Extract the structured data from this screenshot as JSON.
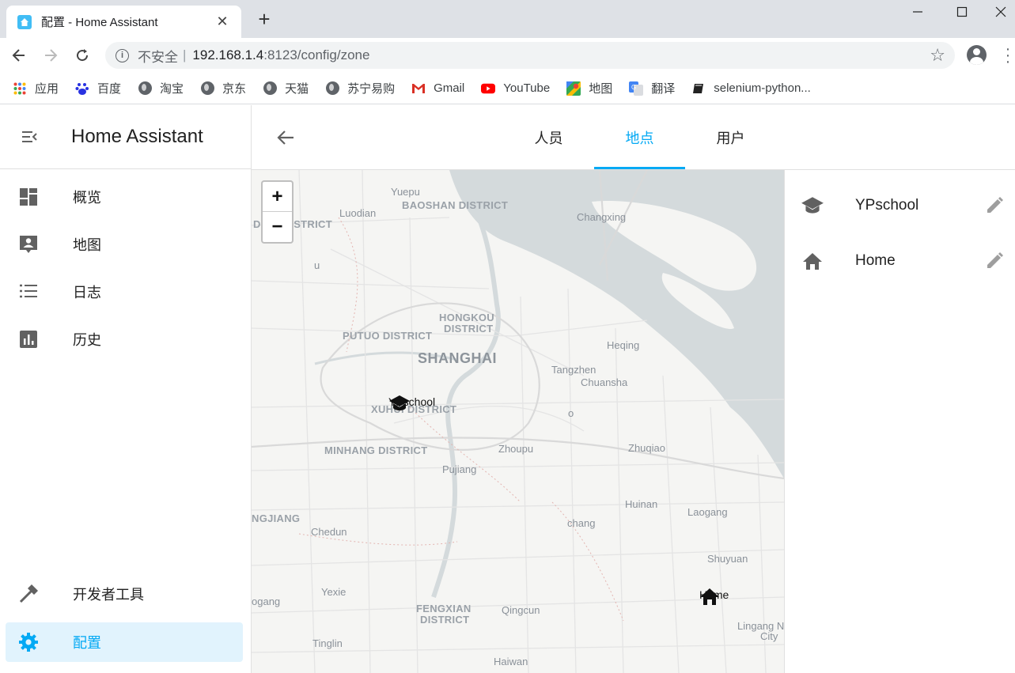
{
  "browser": {
    "tab_title": "配置 - Home Assistant",
    "new_tab": "+",
    "address": {
      "insecure_label": "不安全",
      "separator": "|",
      "host": "192.168.1.4",
      "path": ":8123/config/zone"
    },
    "bookmarks": [
      {
        "label": "应用",
        "icon": "apps-grid-icon"
      },
      {
        "label": "百度",
        "icon": "baidu-paw-icon"
      },
      {
        "label": "淘宝",
        "icon": "globe-icon"
      },
      {
        "label": "京东",
        "icon": "globe-icon"
      },
      {
        "label": "天猫",
        "icon": "globe-icon"
      },
      {
        "label": "苏宁易购",
        "icon": "globe-icon"
      },
      {
        "label": "Gmail",
        "icon": "gmail-icon"
      },
      {
        "label": "YouTube",
        "icon": "youtube-icon"
      },
      {
        "label": "地图",
        "icon": "maps-icon"
      },
      {
        "label": "翻译",
        "icon": "translate-icon"
      },
      {
        "label": "selenium-python...",
        "icon": "book-icon"
      }
    ]
  },
  "sidebar": {
    "title": "Home Assistant",
    "items": [
      {
        "label": "概览",
        "icon": "dashboard-icon"
      },
      {
        "label": "地图",
        "icon": "map-account-icon"
      },
      {
        "label": "日志",
        "icon": "logbook-list-icon"
      },
      {
        "label": "历史",
        "icon": "history-chart-icon"
      }
    ],
    "bottom_items": [
      {
        "label": "开发者工具",
        "icon": "hammer-icon"
      },
      {
        "label": "配置",
        "icon": "cog-icon",
        "active": true
      }
    ]
  },
  "topbar": {
    "tabs": [
      {
        "label": "人员",
        "active": false
      },
      {
        "label": "地点",
        "active": true
      },
      {
        "label": "用户",
        "active": false
      }
    ]
  },
  "map": {
    "zoom_in": "+",
    "zoom_out": "−",
    "labels": {
      "yuepu": "Yuepu",
      "baoshan": "BAOSHAN DISTRICT",
      "luodian": "Luodian",
      "jiading": "DING DISTRICT",
      "changxing": "Changxing",
      "hongkou1": "HONGKOU",
      "hongkou2": "DISTRICT",
      "putuo": "PUTUO DISTRICT",
      "shanghai": "SHANGHAI",
      "heqing": "Heqing",
      "tangzhen": "Tangzhen",
      "chuansha": "Chuansha",
      "xuhui": "XUHUI DISTRICT",
      "minhang": "MINHANG DISTRICT",
      "zhoupu": "Zhoupu",
      "zhuqiao": "Zhuqiao",
      "pujiang": "Pujiang",
      "huinan": "Huinan",
      "laogang": "Laogang",
      "songjiang": "NGJIANG",
      "chedun": "Chedun",
      "chang": "chang",
      "shuyuan": "Shuyuan",
      "yexie": "Yexie",
      "ogang": "ogang",
      "fengxian1": "FENGXIAN",
      "fengxian2": "DISTRICT",
      "qingcun": "Qingcun",
      "lingang1": "Lingang N",
      "lingang2": "City",
      "tinglin": "Tinglin",
      "haiwan": "Haiwan",
      "u": "u",
      "o": "o"
    },
    "markers": [
      {
        "label": "YPschool",
        "icon": "school-icon"
      },
      {
        "label": "Home",
        "icon": "home-icon"
      }
    ]
  },
  "zones": [
    {
      "name": "YPschool",
      "icon": "school-icon"
    },
    {
      "name": "Home",
      "icon": "home-icon"
    }
  ],
  "colors": {
    "accent": "#03a9f4",
    "active_bg": "#e1f3fd",
    "water": "#d4dadc",
    "land": "#f5f5f3"
  }
}
